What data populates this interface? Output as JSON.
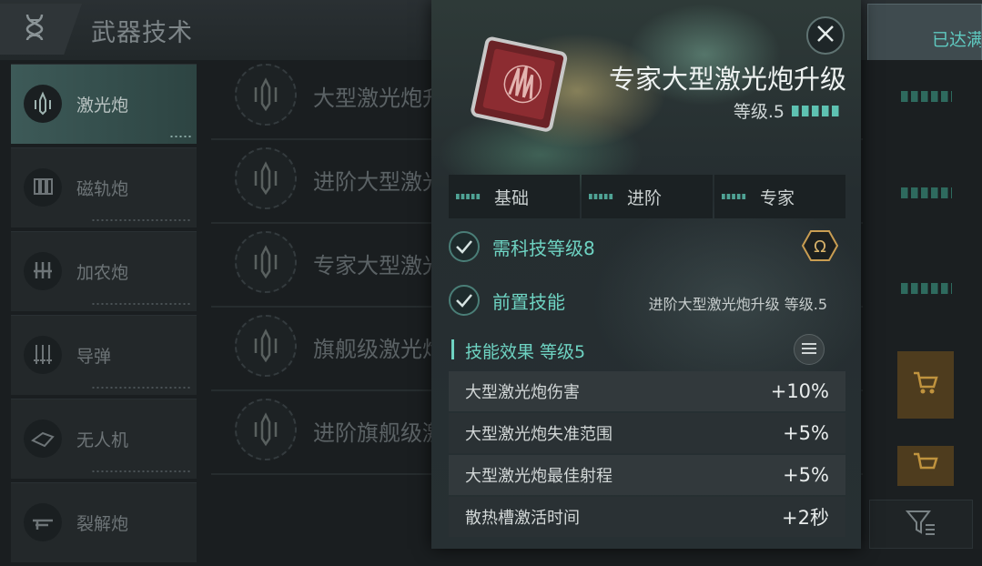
{
  "header": {
    "title": "武器技术",
    "reached_label": "已达满"
  },
  "sidebar": {
    "items": [
      {
        "label": "激光炮",
        "active": true
      },
      {
        "label": "磁轨炮",
        "active": false
      },
      {
        "label": "加农炮",
        "active": false
      },
      {
        "label": "导弹",
        "active": false
      },
      {
        "label": "无人机",
        "active": false
      },
      {
        "label": "裂解炮",
        "active": false
      }
    ]
  },
  "skills": [
    {
      "label": "大型激光炮升"
    },
    {
      "label": "进阶大型激光"
    },
    {
      "label": "专家大型激光"
    },
    {
      "label": "旗舰级激光炮"
    },
    {
      "label": "进阶旗舰级激"
    }
  ],
  "modal": {
    "title": "专家大型激光炮升级",
    "level": "等级.5",
    "tabs": [
      {
        "label": "基础"
      },
      {
        "label": "进阶"
      },
      {
        "label": "专家"
      }
    ],
    "requirements": [
      {
        "label": "需科技等级8",
        "value": ""
      },
      {
        "label": "前置技能",
        "value": "进阶大型激光炮升级 等级.5"
      }
    ],
    "effects_title": "技能效果 等级5",
    "effects": [
      {
        "name": "大型激光炮伤害",
        "value": "+10%"
      },
      {
        "name": "大型激光炮失准范围",
        "value": "+5%"
      },
      {
        "name": "大型激光炮最佳射程",
        "value": "+5%"
      },
      {
        "name": "散热槽激活时间",
        "value": "+2秒"
      }
    ]
  },
  "colors": {
    "accent": "#6ed3c2",
    "cart": "#4e3c1e",
    "panel": "#262e31"
  },
  "icons": {
    "back": "dna-icon",
    "close": "close-icon",
    "omega": "omega-icon",
    "list": "list-icon",
    "cart": "cart-icon",
    "filter": "filter-icon",
    "check": "check-icon"
  }
}
